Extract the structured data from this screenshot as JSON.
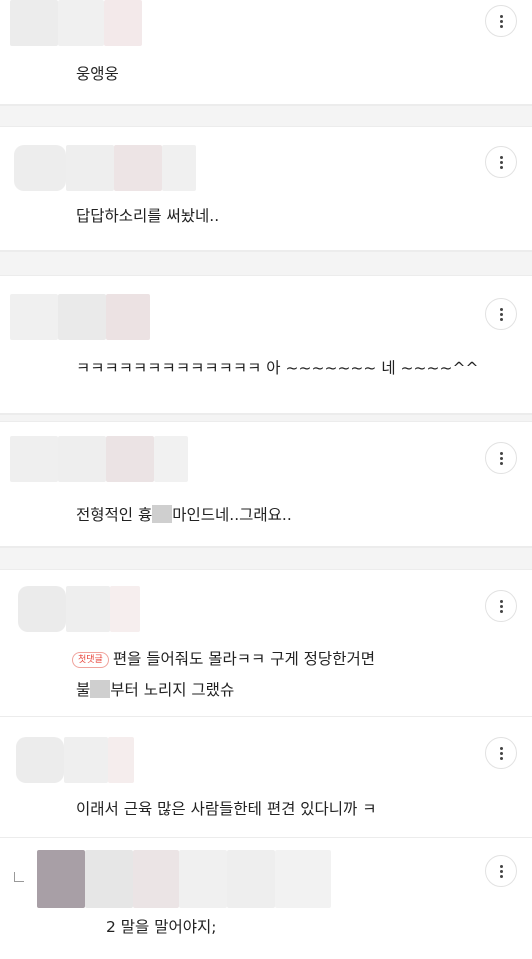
{
  "comments": [
    {
      "text": "웅앵웅"
    },
    {
      "text": "답답하소리를 써놨네.."
    },
    {
      "text": "ㅋㅋㅋㅋㅋㅋㅋㅋㅋㅋㅋㅋㅋ 아 ~~~~~~~ 네 ~~~~^^"
    },
    {
      "text_before": "전형적인 흉",
      "text_after": "마인드네..그래요.."
    },
    {
      "badge": "첫댓글",
      "line1": "편을 들어줘도 몰라ㅋㅋ 구게 정당한거면",
      "line2_before": "불",
      "line2_after": "부터 노리지 그랬슈"
    },
    {
      "text": "이래서 근육 많은 사람들한테 편견 있다니까 ㅋ"
    },
    {
      "text": "2 말을 말어야지;"
    }
  ],
  "colors": {
    "badge": "#e8473d",
    "divider": "#ececec",
    "gap": "#f4f4f4"
  },
  "icons": {
    "more": "vertical-ellipsis-icon",
    "reply": "reply-arrow-icon"
  }
}
